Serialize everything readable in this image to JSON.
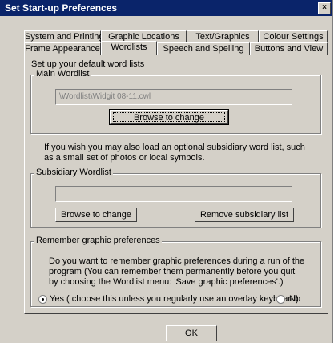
{
  "window": {
    "title": "Set Start-up Preferences",
    "close_glyph": "×"
  },
  "tabs": {
    "row1": [
      "System and Printing",
      "Graphic Locations",
      "Text/Graphics",
      "Colour Settings"
    ],
    "row2": [
      "Frame Appearance",
      "Wordlists",
      "Speech and Spelling",
      "Buttons and View"
    ],
    "active": "Wordlists"
  },
  "panel": {
    "intro": "Set up your default word lists",
    "main_wordlist": {
      "label": "Main Wordlist",
      "path": "\\Wordlist\\Widgit 08-11.cwl",
      "browse_label": "Browse to change"
    },
    "subsidiary_info": "If you wish you may also load an optional subsidiary word list, such as a small set of photos or local symbols.",
    "subsidiary_wordlist": {
      "label": "Subsidiary Wordlist",
      "path": "",
      "browse_label": "Browse to change",
      "remove_label": "Remove subsidiary list"
    },
    "remember": {
      "label": "Remember graphic preferences",
      "description": "Do you want to remember graphic preferences during a run of the program (You can remember them permanently before you quit by choosing the Wordlist menu: 'Save graphic preferences'.)",
      "yes_label": "Yes ( choose this unless you regularly use an overlay keyboard)",
      "no_label": "No",
      "selected": "Yes"
    }
  },
  "ok_label": "OK"
}
